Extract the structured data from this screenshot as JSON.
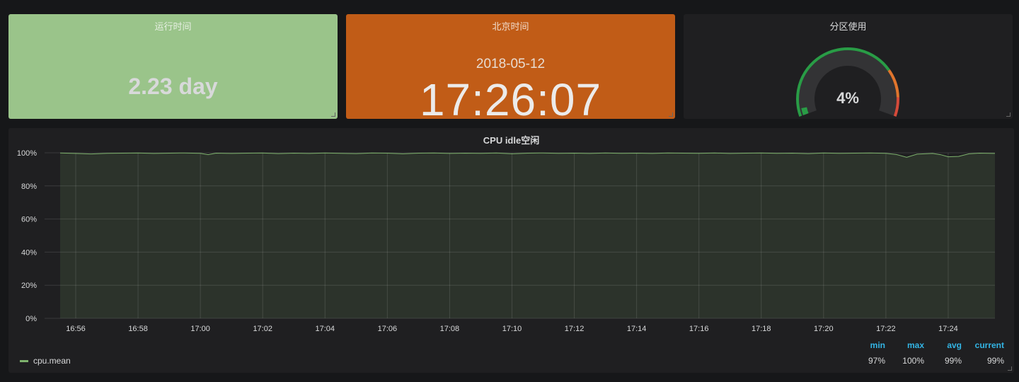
{
  "uptime": {
    "title": "运行时间",
    "value": "2.23 day",
    "background": "#9ac48a"
  },
  "clock": {
    "title": "北京时间",
    "date": "2018-05-12",
    "time": "17:26:07",
    "background": "#c15c17"
  },
  "gauge": {
    "title": "分区使用",
    "value": 4,
    "value_text": "4%",
    "min": 0,
    "max": 100,
    "colors": {
      "ok": "#299c46",
      "warn": "#e0752d",
      "critical": "#d44a3a",
      "value_bar": "#299c46"
    }
  },
  "graph": {
    "title": "CPU idle空闲",
    "legend": {
      "series_name": "cpu.mean",
      "headers": {
        "min": "min",
        "max": "max",
        "avg": "avg",
        "current": "current"
      },
      "values": {
        "min": "97%",
        "max": "100%",
        "avg": "99%",
        "current": "99%"
      }
    }
  },
  "chart_data": {
    "type": "line",
    "title": "CPU idle空闲",
    "xlabel": "",
    "ylabel": "",
    "y_ticks": [
      "0%",
      "20%",
      "40%",
      "60%",
      "80%",
      "100%"
    ],
    "ylim": [
      0,
      100
    ],
    "x_ticks": [
      "16:56",
      "16:58",
      "17:00",
      "17:02",
      "17:04",
      "17:06",
      "17:08",
      "17:10",
      "17:12",
      "17:14",
      "17:16",
      "17:18",
      "17:20",
      "17:22",
      "17:24"
    ],
    "xlim": [
      "16:55:30",
      "17:25:30"
    ],
    "grid": true,
    "legend_placement": "bottom-left",
    "series": [
      {
        "name": "cpu.mean",
        "color": "#7eb26d",
        "points": [
          [
            "16:55:30",
            99.9
          ],
          [
            "16:56:00",
            99.6
          ],
          [
            "16:56:30",
            99.3
          ],
          [
            "16:57:00",
            99.7
          ],
          [
            "16:57:30",
            99.8
          ],
          [
            "16:58:00",
            99.9
          ],
          [
            "16:58:30",
            99.6
          ],
          [
            "16:59:00",
            99.8
          ],
          [
            "16:59:30",
            99.9
          ],
          [
            "17:00:00",
            99.7
          ],
          [
            "17:00:15",
            98.9
          ],
          [
            "17:00:30",
            99.8
          ],
          [
            "17:01:00",
            99.6
          ],
          [
            "17:01:30",
            99.8
          ],
          [
            "17:02:00",
            99.9
          ],
          [
            "17:02:30",
            99.5
          ],
          [
            "17:03:00",
            99.8
          ],
          [
            "17:03:30",
            99.6
          ],
          [
            "17:04:00",
            99.9
          ],
          [
            "17:04:30",
            99.7
          ],
          [
            "17:05:00",
            99.5
          ],
          [
            "17:05:30",
            99.9
          ],
          [
            "17:06:00",
            99.8
          ],
          [
            "17:06:30",
            99.4
          ],
          [
            "17:07:00",
            99.8
          ],
          [
            "17:07:30",
            99.9
          ],
          [
            "17:08:00",
            99.6
          ],
          [
            "17:08:30",
            99.8
          ],
          [
            "17:09:00",
            99.7
          ],
          [
            "17:09:30",
            99.9
          ],
          [
            "17:10:00",
            99.4
          ],
          [
            "17:10:30",
            99.8
          ],
          [
            "17:11:00",
            99.9
          ],
          [
            "17:11:30",
            99.7
          ],
          [
            "17:12:00",
            99.8
          ],
          [
            "17:12:30",
            99.6
          ],
          [
            "17:13:00",
            99.9
          ],
          [
            "17:13:30",
            99.7
          ],
          [
            "17:14:00",
            99.8
          ],
          [
            "17:14:30",
            99.6
          ],
          [
            "17:15:00",
            99.9
          ],
          [
            "17:15:30",
            99.8
          ],
          [
            "17:16:00",
            99.7
          ],
          [
            "17:16:30",
            99.9
          ],
          [
            "17:17:00",
            99.6
          ],
          [
            "17:17:30",
            99.8
          ],
          [
            "17:18:00",
            99.9
          ],
          [
            "17:18:30",
            99.7
          ],
          [
            "17:19:00",
            99.8
          ],
          [
            "17:19:30",
            99.5
          ],
          [
            "17:20:00",
            99.9
          ],
          [
            "17:20:30",
            99.7
          ],
          [
            "17:21:00",
            99.8
          ],
          [
            "17:21:30",
            99.9
          ],
          [
            "17:22:00",
            99.7
          ],
          [
            "17:22:20",
            99.0
          ],
          [
            "17:22:40",
            97.3
          ],
          [
            "17:23:00",
            99.2
          ],
          [
            "17:23:30",
            99.6
          ],
          [
            "17:23:45",
            98.9
          ],
          [
            "17:24:00",
            97.6
          ],
          [
            "17:24:20",
            97.8
          ],
          [
            "17:24:40",
            99.4
          ],
          [
            "17:25:00",
            99.8
          ],
          [
            "17:25:30",
            99.6
          ]
        ]
      }
    ]
  }
}
